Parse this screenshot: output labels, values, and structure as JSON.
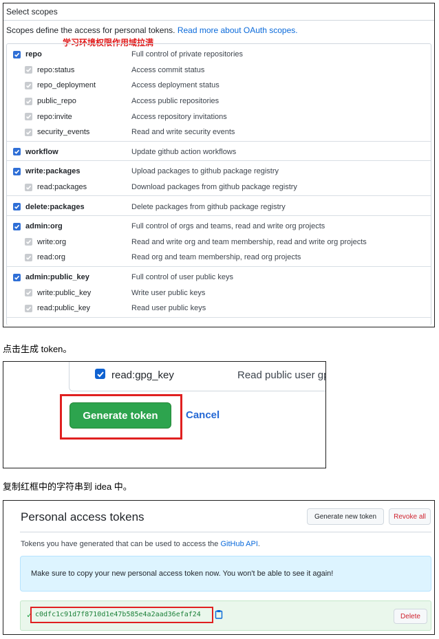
{
  "scopes": {
    "title": "Select scopes",
    "description": "Scopes define the access for personal tokens. ",
    "description_link": "Read more about OAuth scopes.",
    "annotation": "学习环境权限作用域拉满",
    "groups": [
      {
        "items": [
          {
            "name": "repo",
            "desc": "Full control of private repositories",
            "level": "parent",
            "checked": true
          },
          {
            "name": "repo:status",
            "desc": "Access commit status",
            "level": "child",
            "checked": true
          },
          {
            "name": "repo_deployment",
            "desc": "Access deployment status",
            "level": "child",
            "checked": true
          },
          {
            "name": "public_repo",
            "desc": "Access public repositories",
            "level": "child",
            "checked": true
          },
          {
            "name": "repo:invite",
            "desc": "Access repository invitations",
            "level": "child",
            "checked": true
          },
          {
            "name": "security_events",
            "desc": "Read and write security events",
            "level": "child",
            "checked": true
          }
        ]
      },
      {
        "items": [
          {
            "name": "workflow",
            "desc": "Update github action workflows",
            "level": "parent",
            "checked": true
          }
        ]
      },
      {
        "items": [
          {
            "name": "write:packages",
            "desc": "Upload packages to github package registry",
            "level": "parent",
            "checked": true
          },
          {
            "name": "read:packages",
            "desc": "Download packages from github package registry",
            "level": "child",
            "checked": true
          }
        ]
      },
      {
        "items": [
          {
            "name": "delete:packages",
            "desc": "Delete packages from github package registry",
            "level": "parent",
            "checked": true
          }
        ]
      },
      {
        "items": [
          {
            "name": "admin:org",
            "desc": "Full control of orgs and teams, read and write org projects",
            "level": "parent",
            "checked": true
          },
          {
            "name": "write:org",
            "desc": "Read and write org and team membership, read and write org projects",
            "level": "child",
            "checked": true
          },
          {
            "name": "read:org",
            "desc": "Read org and team membership, read org projects",
            "level": "child",
            "checked": true
          }
        ]
      },
      {
        "items": [
          {
            "name": "admin:public_key",
            "desc": "Full control of user public keys",
            "level": "parent",
            "checked": true
          },
          {
            "name": "write:public_key",
            "desc": "Write user public keys",
            "level": "child",
            "checked": true
          },
          {
            "name": "read:public_key",
            "desc": "Read user public keys",
            "level": "child",
            "checked": true
          }
        ]
      }
    ]
  },
  "caption1": "点击生成 token。",
  "generate": {
    "scope_name": "read:gpg_key",
    "scope_desc": "Read public user gpg",
    "generate_label": "Generate token",
    "cancel_label": "Cancel"
  },
  "caption2": "复制红框中的字符串到 idea 中。",
  "tokens": {
    "title": "Personal access tokens",
    "generate_new_label": "Generate new token",
    "revoke_all_label": "Revoke all",
    "description": "Tokens you have generated that can be used to access the ",
    "description_link": "GitHub API",
    "description_end": ".",
    "flash": "Make sure to copy your new personal access token now. You won't be able to see it again!",
    "token_value": "c0dfc1c91d7f8710d1e47b585e4a2aad36efaf24",
    "delete_label": "Delete"
  },
  "colors": {
    "primary_green": "#2da44e",
    "link_blue": "#0969da",
    "danger_red": "#cf222e",
    "highlight_red": "#e02020"
  }
}
